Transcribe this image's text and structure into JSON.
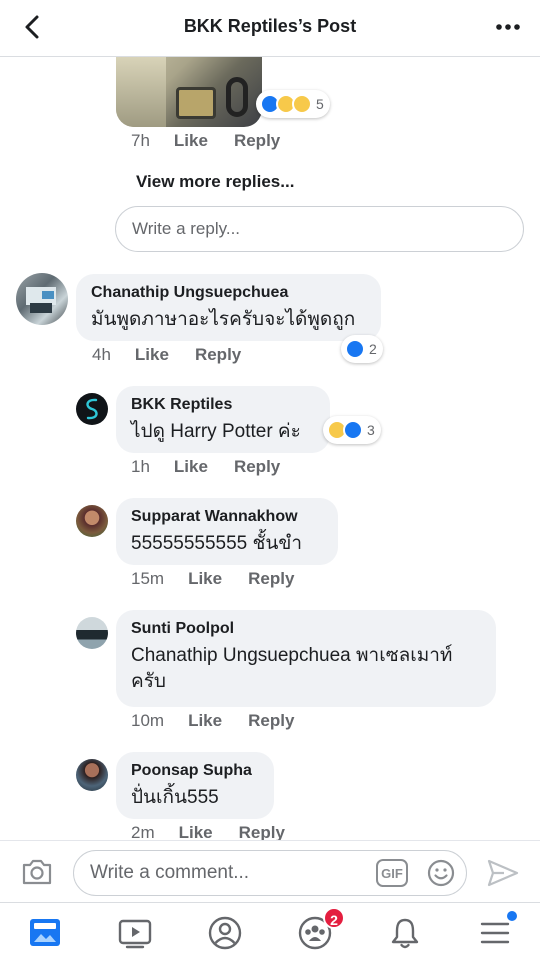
{
  "header": {
    "title": "BKK Reptiles’s Post"
  },
  "prev_reply": {
    "reaction_count": "5",
    "time": "7h",
    "like": "Like",
    "reply": "Reply"
  },
  "view_more": "View more replies...",
  "reply_input": {
    "placeholder": "Write a reply..."
  },
  "comment": {
    "author": "Chanathip Ungsuepchuea",
    "text": "มันพูดภาษาอะไรครับจะได้พูดถูก",
    "reaction_count": "2",
    "time": "4h",
    "like": "Like",
    "reply": "Reply"
  },
  "replies": [
    {
      "author": "BKK Reptiles",
      "text": "ไปดู Harry Potter ค่ะ",
      "reaction_count": "3",
      "time": "1h",
      "like": "Like",
      "reply": "Reply"
    },
    {
      "author": "Supparat Wannakhow",
      "text": "55555555555 ชั้นขำ",
      "time": "15m",
      "like": "Like",
      "reply": "Reply"
    },
    {
      "author": "Sunti Poolpol",
      "text": "Chanathip Ungsuepchuea พาเซลเมาท์ครับ",
      "time": "10m",
      "like": "Like",
      "reply": "Reply"
    },
    {
      "author": "Poonsap Supha",
      "text": "ปั่นเกิ้น555",
      "time": "2m",
      "like": "Like",
      "reply": "Reply"
    }
  ],
  "composer": {
    "placeholder": "Write a comment...",
    "gif_label": "GIF"
  },
  "tabbar": {
    "groups_badge": "2"
  },
  "colors": {
    "accent": "#1877f2",
    "badge": "#e41e3f",
    "bubble": "#f0f2f5"
  }
}
